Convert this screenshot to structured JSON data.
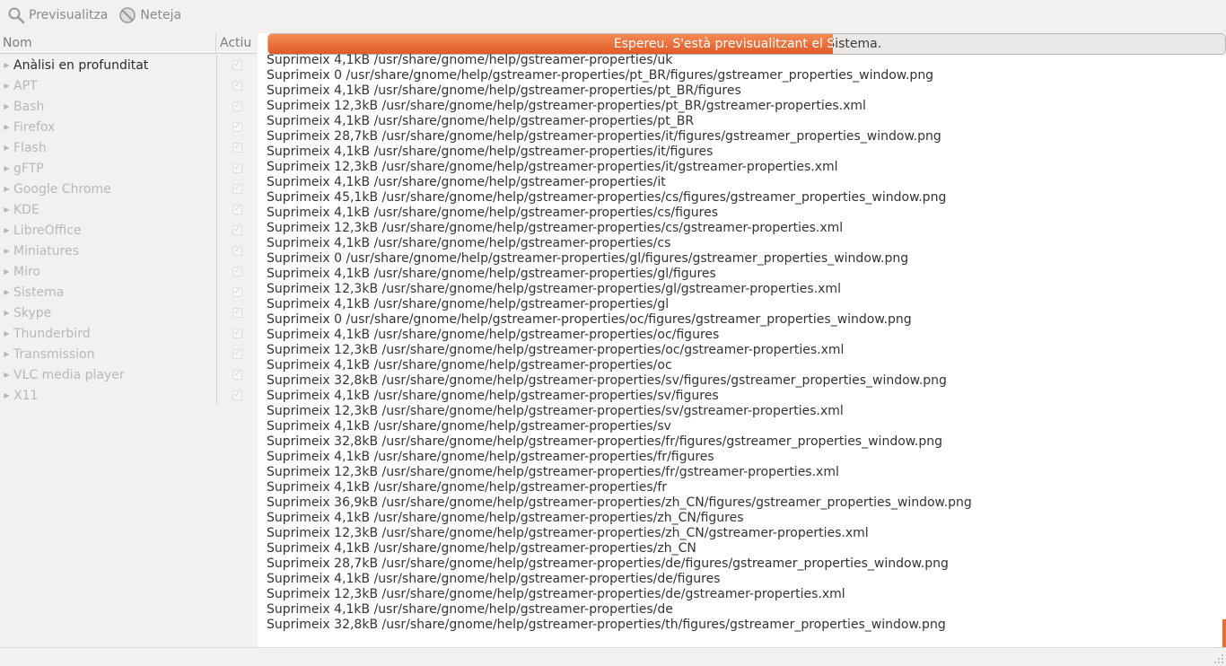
{
  "toolbar": {
    "preview_label": "Previsualitza",
    "clean_label": "Neteja",
    "preview_icon": "search-icon",
    "clean_icon": "no-entry-icon"
  },
  "sidebar": {
    "col_name": "Nom",
    "col_active": "Actiu",
    "items": [
      {
        "label": "Anàlisi en profunditat",
        "enabled": true
      },
      {
        "label": "APT",
        "enabled": false
      },
      {
        "label": "Bash",
        "enabled": false
      },
      {
        "label": "Firefox",
        "enabled": false
      },
      {
        "label": "Flash",
        "enabled": false
      },
      {
        "label": "gFTP",
        "enabled": false
      },
      {
        "label": "Google Chrome",
        "enabled": false
      },
      {
        "label": "KDE",
        "enabled": false
      },
      {
        "label": "LibreOffice",
        "enabled": false
      },
      {
        "label": "Miniatures",
        "enabled": false
      },
      {
        "label": "Miro",
        "enabled": false
      },
      {
        "label": "Sistema",
        "enabled": false
      },
      {
        "label": "Skype",
        "enabled": false
      },
      {
        "label": "Thunderbird",
        "enabled": false
      },
      {
        "label": "Transmission",
        "enabled": false
      },
      {
        "label": "VLC media player",
        "enabled": false
      },
      {
        "label": "X11",
        "enabled": false
      }
    ]
  },
  "progress": {
    "text": "Espereu.  S'està previsualitzant el Sistema.",
    "fraction": 0.59,
    "accent": "#e8693a"
  },
  "log": [
    "Suprimeix 4,1kB /usr/share/gnome/help/gstreamer-properties/uk",
    "Suprimeix 0 /usr/share/gnome/help/gstreamer-properties/pt_BR/figures/gstreamer_properties_window.png",
    "Suprimeix 4,1kB /usr/share/gnome/help/gstreamer-properties/pt_BR/figures",
    "Suprimeix 12,3kB /usr/share/gnome/help/gstreamer-properties/pt_BR/gstreamer-properties.xml",
    "Suprimeix 4,1kB /usr/share/gnome/help/gstreamer-properties/pt_BR",
    "Suprimeix 28,7kB /usr/share/gnome/help/gstreamer-properties/it/figures/gstreamer_properties_window.png",
    "Suprimeix 4,1kB /usr/share/gnome/help/gstreamer-properties/it/figures",
    "Suprimeix 12,3kB /usr/share/gnome/help/gstreamer-properties/it/gstreamer-properties.xml",
    "Suprimeix 4,1kB /usr/share/gnome/help/gstreamer-properties/it",
    "Suprimeix 45,1kB /usr/share/gnome/help/gstreamer-properties/cs/figures/gstreamer_properties_window.png",
    "Suprimeix 4,1kB /usr/share/gnome/help/gstreamer-properties/cs/figures",
    "Suprimeix 12,3kB /usr/share/gnome/help/gstreamer-properties/cs/gstreamer-properties.xml",
    "Suprimeix 4,1kB /usr/share/gnome/help/gstreamer-properties/cs",
    "Suprimeix 0 /usr/share/gnome/help/gstreamer-properties/gl/figures/gstreamer_properties_window.png",
    "Suprimeix 4,1kB /usr/share/gnome/help/gstreamer-properties/gl/figures",
    "Suprimeix 12,3kB /usr/share/gnome/help/gstreamer-properties/gl/gstreamer-properties.xml",
    "Suprimeix 4,1kB /usr/share/gnome/help/gstreamer-properties/gl",
    "Suprimeix 0 /usr/share/gnome/help/gstreamer-properties/oc/figures/gstreamer_properties_window.png",
    "Suprimeix 4,1kB /usr/share/gnome/help/gstreamer-properties/oc/figures",
    "Suprimeix 12,3kB /usr/share/gnome/help/gstreamer-properties/oc/gstreamer-properties.xml",
    "Suprimeix 4,1kB /usr/share/gnome/help/gstreamer-properties/oc",
    "Suprimeix 32,8kB /usr/share/gnome/help/gstreamer-properties/sv/figures/gstreamer_properties_window.png",
    "Suprimeix 4,1kB /usr/share/gnome/help/gstreamer-properties/sv/figures",
    "Suprimeix 12,3kB /usr/share/gnome/help/gstreamer-properties/sv/gstreamer-properties.xml",
    "Suprimeix 4,1kB /usr/share/gnome/help/gstreamer-properties/sv",
    "Suprimeix 32,8kB /usr/share/gnome/help/gstreamer-properties/fr/figures/gstreamer_properties_window.png",
    "Suprimeix 4,1kB /usr/share/gnome/help/gstreamer-properties/fr/figures",
    "Suprimeix 12,3kB /usr/share/gnome/help/gstreamer-properties/fr/gstreamer-properties.xml",
    "Suprimeix 4,1kB /usr/share/gnome/help/gstreamer-properties/fr",
    "Suprimeix 36,9kB /usr/share/gnome/help/gstreamer-properties/zh_CN/figures/gstreamer_properties_window.png",
    "Suprimeix 4,1kB /usr/share/gnome/help/gstreamer-properties/zh_CN/figures",
    "Suprimeix 12,3kB /usr/share/gnome/help/gstreamer-properties/zh_CN/gstreamer-properties.xml",
    "Suprimeix 4,1kB /usr/share/gnome/help/gstreamer-properties/zh_CN",
    "Suprimeix 28,7kB /usr/share/gnome/help/gstreamer-properties/de/figures/gstreamer_properties_window.png",
    "Suprimeix 4,1kB /usr/share/gnome/help/gstreamer-properties/de/figures",
    "Suprimeix 12,3kB /usr/share/gnome/help/gstreamer-properties/de/gstreamer-properties.xml",
    "Suprimeix 4,1kB /usr/share/gnome/help/gstreamer-properties/de",
    "Suprimeix 32,8kB /usr/share/gnome/help/gstreamer-properties/th/figures/gstreamer_properties_window.png"
  ]
}
